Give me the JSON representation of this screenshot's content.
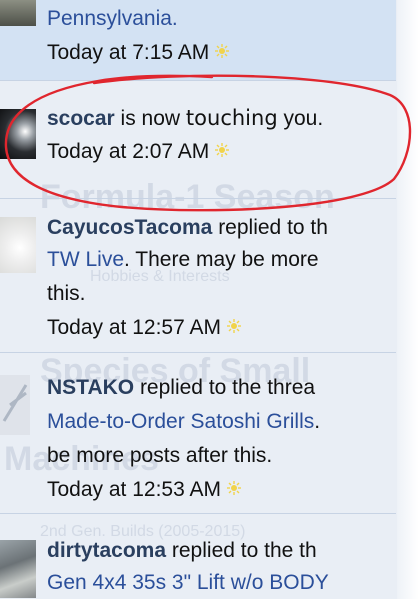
{
  "background_ghost_text": {
    "heading_1": "Formula-1 Season",
    "sub_1": "Hobbies & Interests",
    "heading_2": "Species of Small",
    "heading_3": "Machines",
    "sub_2": "2nd Gen. Builds (2005-2015)"
  },
  "feed": [
    {
      "avatar_icon": "truck-photo-avatar",
      "lines": [
        "Pennsylvania."
      ],
      "line_link": true,
      "time": "Today at 7:15 AM",
      "highlight": true
    },
    {
      "username": "scocar",
      "action_pre": " is now ",
      "action_hand": "touching",
      "action_post": " you.",
      "time": "Today at 2:07 AM",
      "circled": true
    },
    {
      "username": "CayucosTacoma",
      "action": " replied to th",
      "link_line": "TW Live",
      "rest_line": ". There may be more",
      "line3": "this.",
      "time": "Today at 12:57 AM"
    },
    {
      "username": "NSTAKO",
      "action": " replied to the threa",
      "link_line": "Made-to-Order Satoshi Grills",
      "rest_line": ".",
      "line3": "be more posts after this.",
      "time": "Today at 12:53 AM"
    },
    {
      "username": "dirtytacoma",
      "action": " replied to the th",
      "link_line": "Gen 4x4 35s 3\" Lift w/o BODY"
    }
  ],
  "colors": {
    "username": "#2a3f5f",
    "link": "#2b4f9a",
    "highlight_bg": "#d3e2f3",
    "circle": "#e0262e"
  }
}
